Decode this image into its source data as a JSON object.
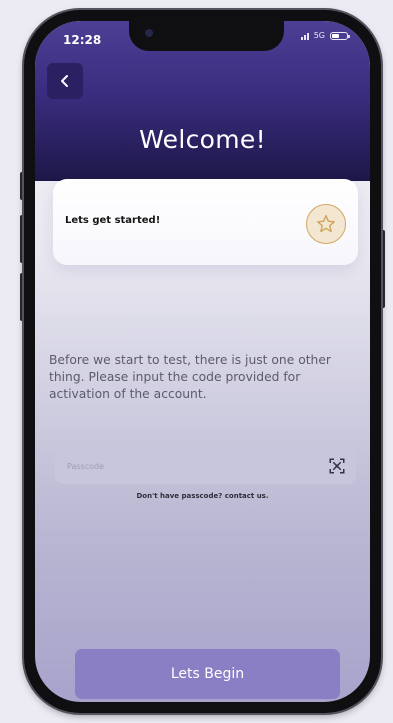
{
  "status_bar": {
    "time": "12:28",
    "network": "5G"
  },
  "header": {
    "back_icon": "chevron-left-icon",
    "title": "Welcome!"
  },
  "card": {
    "title": "Lets get started!",
    "icon": "star-icon"
  },
  "intro_text": "Before we start to test, there is just one other thing. Please input the code provided for activation of the account.",
  "passcode": {
    "placeholder": "Passcode",
    "value": "",
    "icon": "qr-scan-icon"
  },
  "help_text": "Don't have passcode? contact us.",
  "cta_label": "Lets Begin",
  "colors": {
    "header_dark": "#1d1748",
    "header_purple": "#3a2d80",
    "accent_button": "#8a7ec4",
    "star_gold": "#d2a660"
  }
}
